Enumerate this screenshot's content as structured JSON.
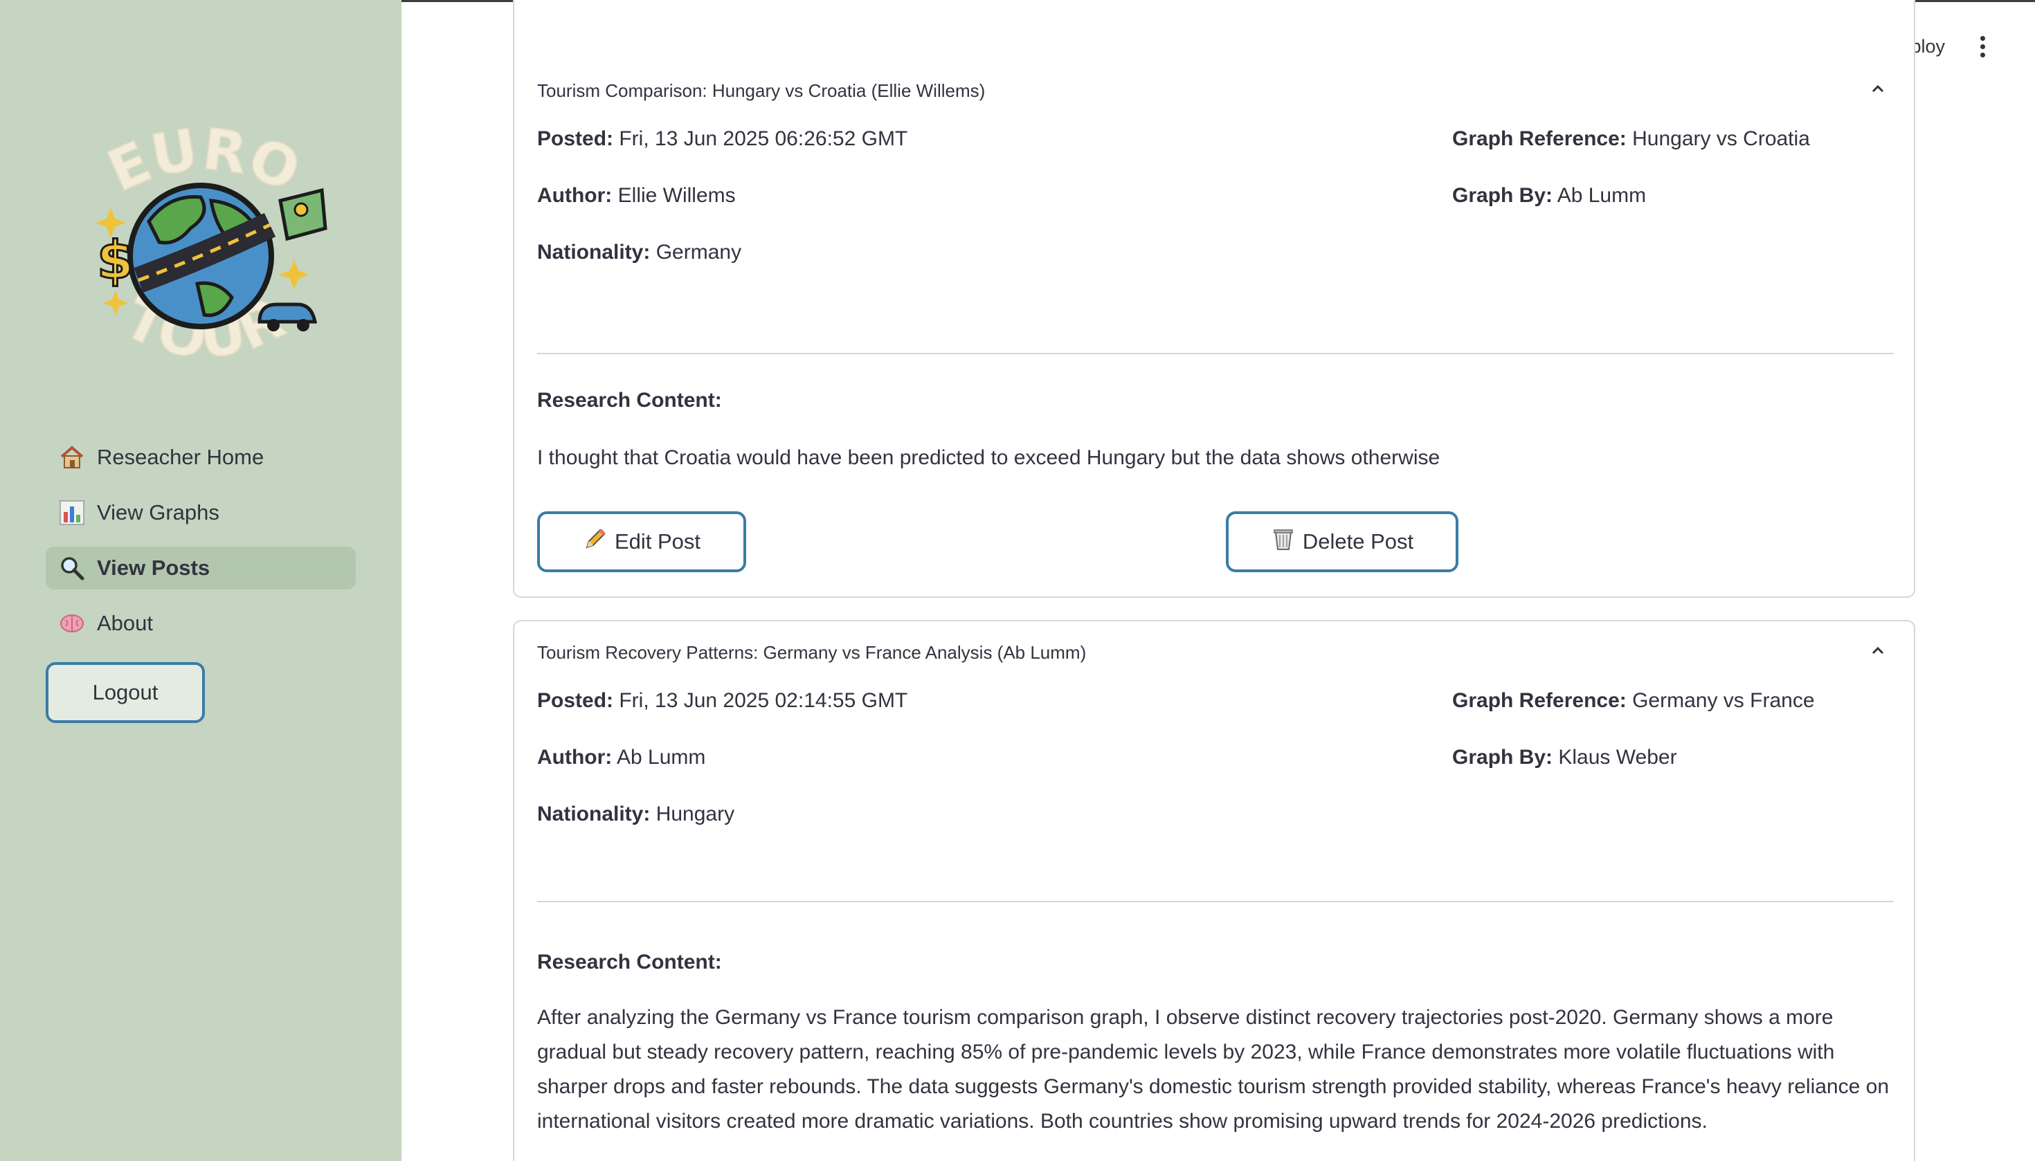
{
  "sidebar": {
    "logo_text_top": "EURO",
    "logo_text_bottom": "TOUR",
    "items": [
      {
        "label": "Reseacher Home",
        "icon": "house-icon"
      },
      {
        "label": "View Graphs",
        "icon": "bar-chart-icon"
      },
      {
        "label": "View Posts",
        "icon": "magnifier-icon",
        "active": true
      },
      {
        "label": "About",
        "icon": "brain-icon"
      }
    ],
    "logout_label": "Logout"
  },
  "header": {
    "deploy_label": "Deploy",
    "menu_icon": "kebab-menu-icon"
  },
  "posts": [
    {
      "title": "Tourism Comparison: Hungary vs Croatia (Ellie Willems)",
      "posted_label": "Posted:",
      "posted": "Fri, 13 Jun 2025 06:26:52 GMT",
      "author_label": "Author:",
      "author": "Ellie Willems",
      "nationality_label": "Nationality:",
      "nationality": "Germany",
      "graph_ref_label": "Graph Reference:",
      "graph_ref": "Hungary vs Croatia",
      "graph_by_label": "Graph By:",
      "graph_by": "Ab Lumm",
      "content_label": "Research Content:",
      "content": "I thought that Croatia would have been predicted to exceed Hungary but the data shows otherwise",
      "edit_label": "Edit Post",
      "delete_label": "Delete Post"
    },
    {
      "title": "Tourism Recovery Patterns: Germany vs France Analysis (Ab Lumm)",
      "posted_label": "Posted:",
      "posted": "Fri, 13 Jun 2025 02:14:55 GMT",
      "author_label": "Author:",
      "author": "Ab Lumm",
      "nationality_label": "Nationality:",
      "nationality": "Hungary",
      "graph_ref_label": "Graph Reference:",
      "graph_ref": "Germany vs France",
      "graph_by_label": "Graph By:",
      "graph_by": "Klaus Weber",
      "content_label": "Research Content:",
      "content": "After analyzing the Germany vs France tourism comparison graph, I observe distinct recovery trajectories post-2020. Germany shows a more gradual but steady recovery pattern, reaching 85% of pre-pandemic levels by 2023, while France demonstrates more volatile fluctuations with sharper drops and faster rebounds. The data suggests Germany's domestic tourism strength provided stability, whereas France's heavy reliance on international visitors created more dramatic variations. Both countries show promising upward trends for 2024-2026 predictions."
    }
  ]
}
